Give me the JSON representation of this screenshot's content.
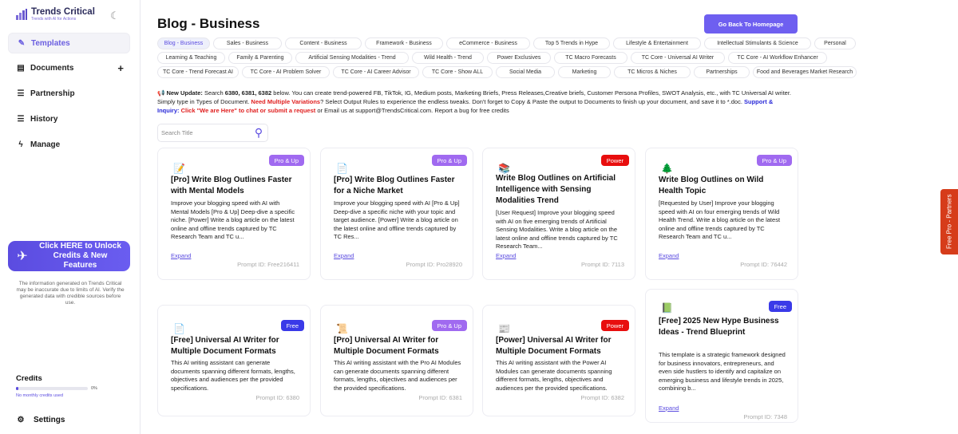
{
  "brand": {
    "title": "Trends Critical",
    "subtitle": "Trends with AI for Actions"
  },
  "nav": [
    {
      "label": "Templates",
      "icon": "edit-icon"
    },
    {
      "label": "Documents",
      "icon": "document-icon"
    },
    {
      "label": "Partnership",
      "icon": "partnership-icon"
    },
    {
      "label": "History",
      "icon": "history-icon"
    },
    {
      "label": "Manage",
      "icon": "bolt-icon"
    }
  ],
  "unlock": {
    "label": "Click HERE to Unlock Credits & New Features"
  },
  "disclaimer": "The information generated on Trends Critical may be inaccurate due to limits of AI. Verify the generated data with credible sources before use.",
  "credits": {
    "label": "Credits",
    "percent": "0%",
    "note": "No monthly credits used",
    "fill_fraction": 0.0
  },
  "settings": {
    "label": "Settings"
  },
  "page": {
    "title": "Blog - Business",
    "back_button": "Go Back To Homepage"
  },
  "tabs_row1": [
    "Blog - Business",
    "Sales - Business",
    "Content - Business",
    "Framework - Business",
    "eCommerce - Business",
    "Top 5 Trends in Hype",
    "Lifestyle & Entertainment",
    "Intellectual Stimulants & Science",
    "Personal"
  ],
  "tabs_row2": [
    "Learning & Teaching",
    "Family & Parenting",
    "Artificial Sensing Modalities - Trend",
    "Wild Health - Trend",
    "Power Exclusives",
    "TC Macro Forecasts",
    "TC Core - Universal AI Writer",
    "TC Core - AI Workflow Enhancer"
  ],
  "tabs_row3": [
    "TC Core - Trend Forecast AI",
    "TC Core - AI Problem Solver",
    "TC Core - AI Career Advisor",
    "TC Core - Show ALL",
    "Social Media",
    "Marketing",
    "TC Micros & Niches",
    "Partnerships",
    "Food and Beverages Market Research"
  ],
  "notice": {
    "prefix": "New Update:",
    "part1": " Search ",
    "ids": "6380, 6381, 6382",
    "part2": " below. You can create trend-powered FB, TikTok, IG, Medium posts, Marketing Briefs, Press Releases,Creative briefs, Customer Persona Profiles, SWOT Analysis, etc., with TC Universal AI writer. Simply type in Types of Document. ",
    "multi": "Need Multiple Variations",
    "part3": "? Select Output Rules to experience the endless tweaks. Don't forget to Copy & Paste the output to Documents to finish up your document, and save it to *.doc. ",
    "support": "Support & Inquiry:",
    "here": " Click \"We are Here\" to chat or submit a request",
    "part4": " or Email us at support@TrendsCritical.com. Report a bug for free credits"
  },
  "search": {
    "placeholder": "Search Title"
  },
  "cards": [
    {
      "badge": "Pro & Up",
      "badge_type": "pro",
      "icon": "pencil-icon",
      "title": "[Pro] Write Blog Outlines Faster with Mental Models",
      "desc": "Improve your blogging speed with AI with Mental Models [Pro & Up] Deep-dive a specific niche. [Power] Write a blog article on the latest online and offline trends captured by TC Research Team and TC u...",
      "expand": "Expand",
      "pid": "Prompt ID: Free216411"
    },
    {
      "badge": "Pro & Up",
      "badge_type": "pro",
      "icon": "note-icon",
      "title": "[Pro] Write Blog Outlines Faster for a Niche Market",
      "desc": "Improve your blogging speed with AI [Pro & Up] Deep-dive a specific niche with your topic and target audience. [Power] Write a blog article on the latest online and offline trends captured by TC Res...",
      "expand": "Expand",
      "pid": "Prompt ID: Pro28920"
    },
    {
      "badge": "Power",
      "badge_type": "power",
      "icon": "books-icon",
      "title": "Write Blog Outlines on Artificial Intelligence with Sensing Modalities Trend",
      "desc": "[User Request] Improve your blogging speed with AI on five emerging trends of Artificial Sensing Modalities.  Write a blog article on the latest online and offline trends captured by TC Research Team...",
      "expand": "Expand",
      "pid": "Prompt ID: 7113"
    },
    {
      "badge": "Pro & Up",
      "badge_type": "pro",
      "icon": "tree-icon",
      "title": "Write Blog Outlines on Wild Health Topic",
      "desc": "[Requested by User] Improve your blogging speed with AI on four emerging trends of Wild Health Trend. Write a blog article on the latest online and offline trends captured by TC Research Team and TC u...",
      "expand": "Expand",
      "pid": "Prompt ID: 76442"
    },
    {
      "badge": "Free",
      "badge_type": "free",
      "icon": "note-icon",
      "title": "[Free] Universal AI Writer for Multiple Document Formats",
      "desc": "This AI writing assistant can generate documents spanning different formats, lengths, objectives and audiences per the provided specifications.",
      "expand": "",
      "pid": "Prompt ID: 6380"
    },
    {
      "badge": "Pro & Up",
      "badge_type": "pro",
      "icon": "scroll-icon",
      "title": "[Pro] Universal AI Writer for Multiple Document Formats",
      "desc": "This AI writing assistant with the Pro AI Modules can generate documents spanning different formats, lengths, objectives and audiences per the provided specifications.",
      "expand": "",
      "pid": "Prompt ID: 6381"
    },
    {
      "badge": "Power",
      "badge_type": "power",
      "icon": "newspaper-icon",
      "title": "[Power] Universal AI Writer for Multiple Document Formats",
      "desc": "This AI writing assistant with the Power AI Modules can generate documents spanning different formats, lengths, objectives and audiences per the provided specifications.",
      "expand": "",
      "pid": "Prompt ID: 6382"
    },
    {
      "badge": "Free",
      "badge_type": "free",
      "icon": "book-icon",
      "title": "[Free] 2025 New Hype Business Ideas - Trend Blueprint",
      "desc": "This template is a strategic framework designed for business innovators, entrepreneurs, and even side hustlers to identify and capitalize on emerging business and lifestyle trends in 2025, combining b...",
      "expand": "Expand",
      "pid": "Prompt ID: 7348"
    }
  ],
  "side_tab": "Free Pro - Partners",
  "colors": {
    "accent": "#6e5ff0",
    "pro": "#a06af0",
    "free": "#3a3ae8",
    "power": "#e80e0e",
    "side_tab": "#d63c1a"
  }
}
